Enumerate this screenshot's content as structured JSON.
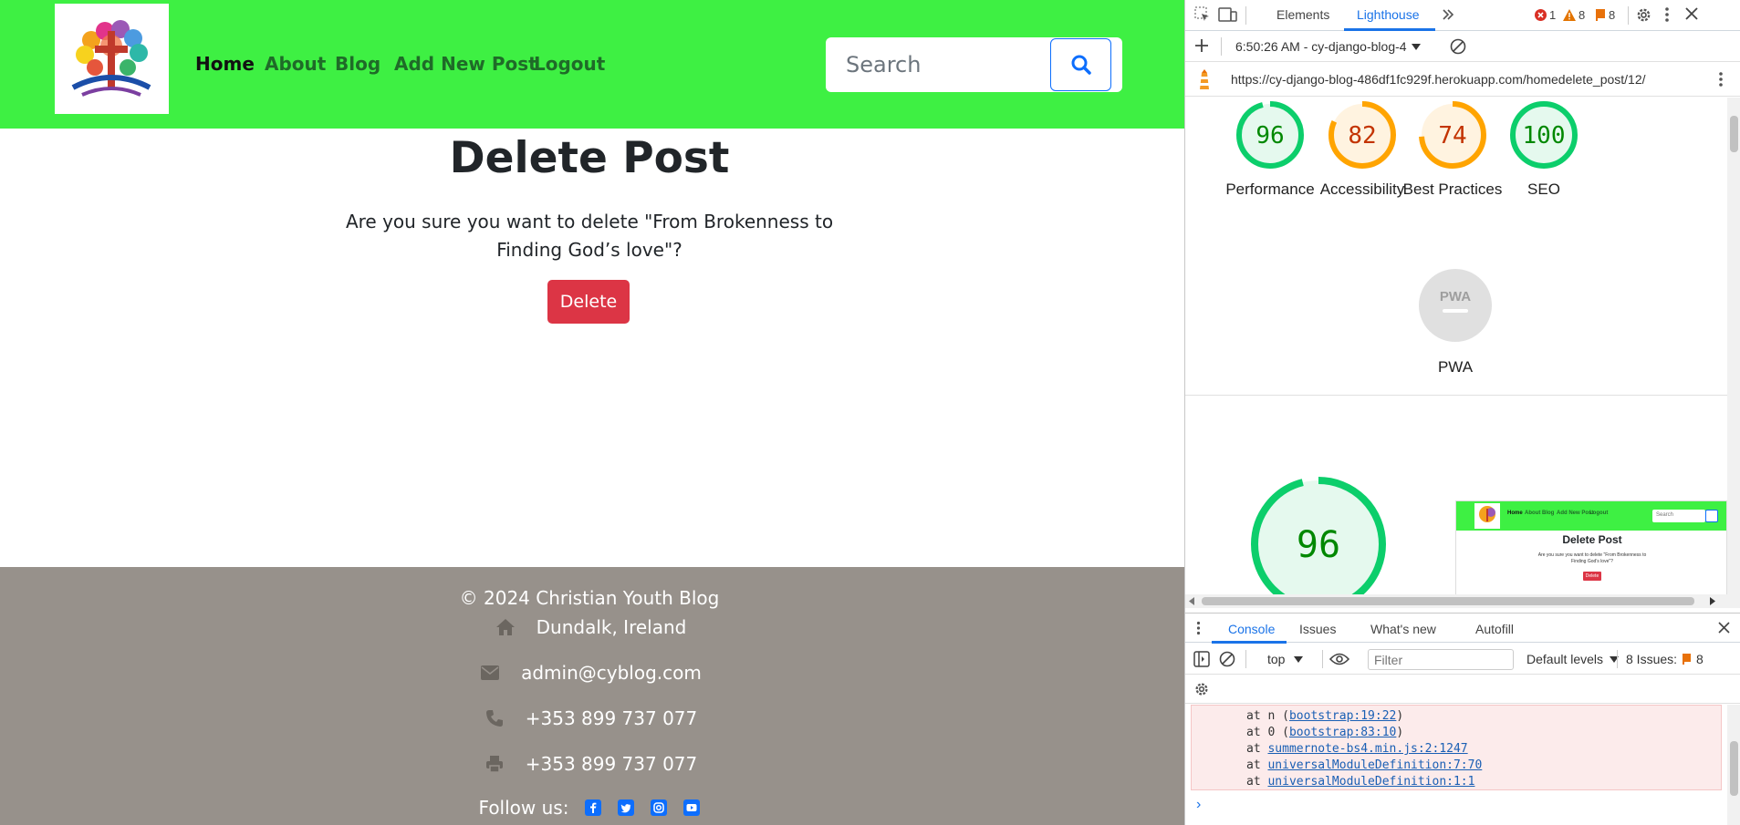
{
  "site": {
    "nav": {
      "home": "Home",
      "about": "About",
      "blog": "Blog",
      "add_post": "Add New Post",
      "logout": "Logout"
    },
    "search": {
      "placeholder": "Search"
    },
    "page_title": "Delete Post",
    "confirm_text": "Are you sure you want to delete \"From Brokenness to Finding God’s love\"?",
    "delete_label": "Delete",
    "footer": {
      "copyright": "© 2024 Christian Youth Blog",
      "address": "Dundalk, Ireland",
      "email": "admin@cyblog.com",
      "phone": "+353 899 737 077",
      "fax": "+353 899 737 077",
      "follow": "Follow us:"
    },
    "colors": {
      "navbar": "#3ef043",
      "footer": "#97918b",
      "danger": "#dc3545",
      "primary": "#0d6efd"
    }
  },
  "devtools": {
    "tabs": {
      "elements": "Elements",
      "lighthouse": "Lighthouse"
    },
    "badges": {
      "errors": "1",
      "warnings": "8",
      "issues": "8"
    },
    "report_select": "6:50:26 AM - cy-django-blog-4",
    "url": "https://cy-django-blog-486df1fc929f.herokuapp.com/homedelete_post/12/",
    "scores": [
      {
        "label": "Performance",
        "value": "96",
        "score": 0.96,
        "color": "#0cce6b"
      },
      {
        "label": "Accessibility",
        "value": "82",
        "score": 0.82,
        "color": "#ffa400"
      },
      {
        "label": "Best Practices",
        "value": "74",
        "score": 0.74,
        "color": "#ffa400"
      },
      {
        "label": "SEO",
        "value": "100",
        "score": 1.0,
        "color": "#0cce6b"
      }
    ],
    "pwa": {
      "label": "PWA",
      "badge": "PWA"
    },
    "big_score": {
      "value": "96",
      "score": 0.96
    },
    "thumbnail": {
      "nav": [
        "Home",
        "About",
        "Blog",
        "Add New Post",
        "Logout"
      ],
      "search": "Search",
      "title": "Delete Post",
      "text": "Are you sure you want to delete \"From Brokenness to Finding God’s love\"?",
      "button": "Delete"
    },
    "drawer_tabs": {
      "console": "Console",
      "issues": "Issues",
      "whats_new": "What's new",
      "autofill": "Autofill"
    },
    "console": {
      "context": "top",
      "filter_placeholder": "Filter",
      "levels": "Default levels",
      "issues_label": "8 Issues:",
      "issues_count": "8",
      "stack": [
        {
          "prefix": "at n (",
          "link": "bootstrap:19:22",
          "suffix": ")"
        },
        {
          "prefix": "at 0 (",
          "link": "bootstrap:83:10",
          "suffix": ")"
        },
        {
          "prefix": "at ",
          "link": "summernote-bs4.min.js:2:1247",
          "suffix": ""
        },
        {
          "prefix": "at ",
          "link": "universalModuleDefinition:7:70",
          "suffix": ""
        },
        {
          "prefix": "at ",
          "link": "universalModuleDefinition:1:1",
          "suffix": ""
        }
      ],
      "prompt": "›"
    }
  }
}
